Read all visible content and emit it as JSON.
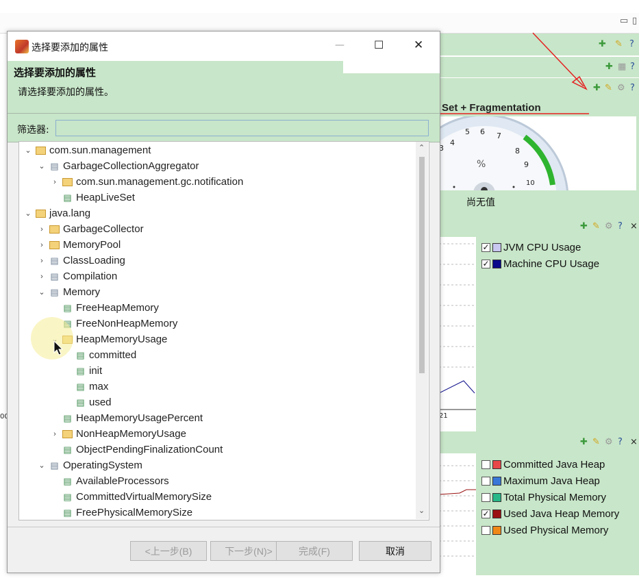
{
  "dialog": {
    "title": "选择要添加的属性",
    "header_title": "选择要添加的属性",
    "header_desc": "请选择要添加的属性。",
    "filter_label": "筛选器:",
    "filter_value": "",
    "buttons": {
      "back": "<上一步(B)",
      "next": "下一步(N)>",
      "finish": "完成(F)",
      "cancel": "取消"
    },
    "window_controls": {
      "minimize": "—",
      "maximize": "☐",
      "close": "✕"
    }
  },
  "tree": [
    {
      "label": "com.sun.management",
      "icon": "folder-icon",
      "toggle": "expanded"
    },
    {
      "label": "GarbageCollectionAggregator",
      "icon": "mbean-icon",
      "toggle": "expanded"
    },
    {
      "label": "com.sun.management.gc.notification",
      "icon": "attribute-folder-icon",
      "toggle": "collapsed"
    },
    {
      "label": "HeapLiveSet",
      "icon": "attribute-icon",
      "toggle": "none"
    },
    {
      "label": "java.lang",
      "icon": "folder-icon",
      "toggle": "expanded"
    },
    {
      "label": "GarbageCollector",
      "icon": "folder-icon",
      "toggle": "collapsed"
    },
    {
      "label": "MemoryPool",
      "icon": "folder-icon",
      "toggle": "collapsed"
    },
    {
      "label": "ClassLoading",
      "icon": "mbean-icon",
      "toggle": "collapsed"
    },
    {
      "label": "Compilation",
      "icon": "mbean-icon",
      "toggle": "collapsed"
    },
    {
      "label": "Memory",
      "icon": "mbean-icon",
      "toggle": "expanded"
    },
    {
      "label": "FreeHeapMemory",
      "icon": "attribute-icon",
      "toggle": "none"
    },
    {
      "label": "FreeNonHeapMemory",
      "icon": "attribute-icon",
      "toggle": "none"
    },
    {
      "label": "HeapMemoryUsage",
      "icon": "attribute-folder-icon",
      "toggle": "expanded"
    },
    {
      "label": "committed",
      "icon": "attribute-icon",
      "toggle": "none"
    },
    {
      "label": "init",
      "icon": "attribute-icon",
      "toggle": "none"
    },
    {
      "label": "max",
      "icon": "attribute-icon",
      "toggle": "none"
    },
    {
      "label": "used",
      "icon": "attribute-icon",
      "toggle": "none"
    },
    {
      "label": "HeapMemoryUsagePercent",
      "icon": "attribute-icon",
      "toggle": "none"
    },
    {
      "label": "NonHeapMemoryUsage",
      "icon": "attribute-folder-icon",
      "toggle": "collapsed"
    },
    {
      "label": "ObjectPendingFinalizationCount",
      "icon": "attribute-icon",
      "toggle": "none"
    },
    {
      "label": "OperatingSystem",
      "icon": "mbean-icon",
      "toggle": "expanded"
    },
    {
      "label": "AvailableProcessors",
      "icon": "attribute-icon",
      "toggle": "none"
    },
    {
      "label": "CommittedVirtualMemorySize",
      "icon": "attribute-icon",
      "toggle": "none"
    },
    {
      "label": "FreePhysicalMemorySize",
      "icon": "attribute-icon",
      "toggle": "none"
    }
  ],
  "background": {
    "gauge_title": "Set + Fragmentation",
    "gauge_unit": "%",
    "gauge_ticks": [
      "3",
      "4",
      "5",
      "6",
      "7",
      "8",
      "9",
      "10"
    ],
    "gauge_value_text": "尚无值",
    "cpu_legend": [
      {
        "label": "JVM CPU Usage",
        "checked": true,
        "color": "#c8c8f0"
      },
      {
        "label": "Machine CPU Usage",
        "checked": true,
        "color": "#0a0a8a"
      }
    ],
    "memory_legend": [
      {
        "label": "Committed Java Heap",
        "checked": false,
        "color": "#e84848"
      },
      {
        "label": "Maximum Java Heap",
        "checked": false,
        "color": "#3a78d8"
      },
      {
        "label": "Total Physical Memory",
        "checked": false,
        "color": "#28b888"
      },
      {
        "label": "Used Java Heap Memory",
        "checked": true,
        "color": "#9a1010"
      },
      {
        "label": "Used Physical Memory",
        "checked": false,
        "color": "#f08818"
      }
    ],
    "chart_fragments": {
      "left_tick": "00",
      "right_tick": "21"
    }
  }
}
